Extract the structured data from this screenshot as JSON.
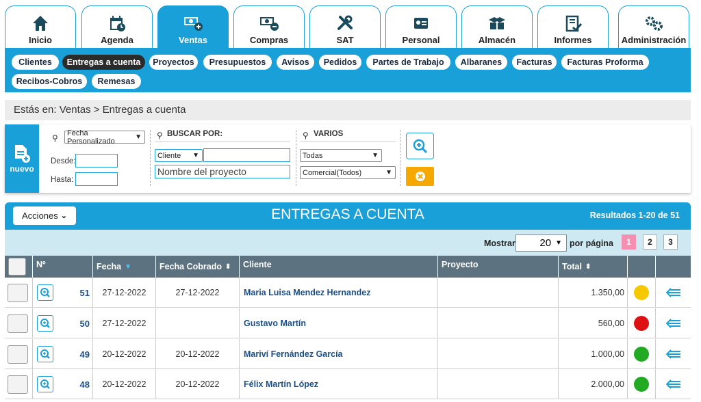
{
  "top_tabs": [
    {
      "label": "Inicio",
      "icon": "home-icon"
    },
    {
      "label": "Agenda",
      "icon": "calendar-icon"
    },
    {
      "label": "Ventas",
      "icon": "money-plus-icon",
      "active": true
    },
    {
      "label": "Compras",
      "icon": "money-minus-icon"
    },
    {
      "label": "SAT",
      "icon": "tools-icon"
    },
    {
      "label": "Personal",
      "icon": "id-card-icon"
    },
    {
      "label": "Almacén",
      "icon": "boxes-icon"
    },
    {
      "label": "Informes",
      "icon": "clipboard-check-icon"
    },
    {
      "label": "Administración",
      "icon": "gears-icon"
    }
  ],
  "sub_nav": [
    "Clientes",
    "Entregas a cuenta",
    "Proyectos",
    "Presupuestos",
    "Avisos",
    "Pedidos",
    "Partes de Trabajo",
    "Albaranes",
    "Facturas",
    "Facturas Proforma",
    "Recibos-Cobros",
    "Remesas"
  ],
  "sub_nav_active": "Entregas a cuenta",
  "breadcrumb": "Estás en: Ventas > Entregas a cuenta",
  "filter": {
    "nuevo_label": "nuevo",
    "date_mode": "Fecha Personalizado",
    "desde_label": "Desde:",
    "hasta_label": "Hasta:",
    "buscar_por_label": "BUSCAR POR:",
    "buscar_field": "Cliente",
    "buscar_value": "",
    "proyecto_placeholder": "Nombre del proyecto",
    "varios_label": "VARIOS",
    "estado": "Todas",
    "comercial": "Comercial(Todos)"
  },
  "results": {
    "acciones_label": "Acciones",
    "title": "ENTREGAS A CUENTA",
    "count": "Resultados 1-20 de 51",
    "mostrar_label": "Mostrar",
    "per_page": "20",
    "por_pagina_label": "por página",
    "pages": [
      "1",
      "2",
      "3"
    ]
  },
  "table": {
    "headers": [
      "Nº",
      "Fecha",
      "Fecha Cobrado",
      "Cliente",
      "Proyecto",
      "Total"
    ],
    "rows": [
      {
        "num": "51",
        "fecha": "27-12-2022",
        "cobrado": "27-12-2022",
        "cliente": "Maria Luisa Mendez Hernandez",
        "proyecto": "",
        "total": "1.350,00",
        "status_color": "#f5c800"
      },
      {
        "num": "50",
        "fecha": "27-12-2022",
        "cobrado": "",
        "cliente": "Gustavo Martín",
        "proyecto": "",
        "total": "560,00",
        "status_color": "#dd1111"
      },
      {
        "num": "49",
        "fecha": "20-12-2022",
        "cobrado": "20-12-2022",
        "cliente": "Mariví Fernández García",
        "proyecto": "",
        "total": "1.000,00",
        "status_color": "#22aa22"
      },
      {
        "num": "48",
        "fecha": "20-12-2022",
        "cobrado": "20-12-2022",
        "cliente": "Félix Martín López",
        "proyecto": "",
        "total": "2.000,00",
        "status_color": "#22aa22"
      }
    ]
  },
  "colors": {
    "accent": "#1aa0d8",
    "header_dark": "#5d7280",
    "pager_bg": "#cfe9f3",
    "active_page": "#f48fb1",
    "clear_btn": "#f5a800"
  }
}
